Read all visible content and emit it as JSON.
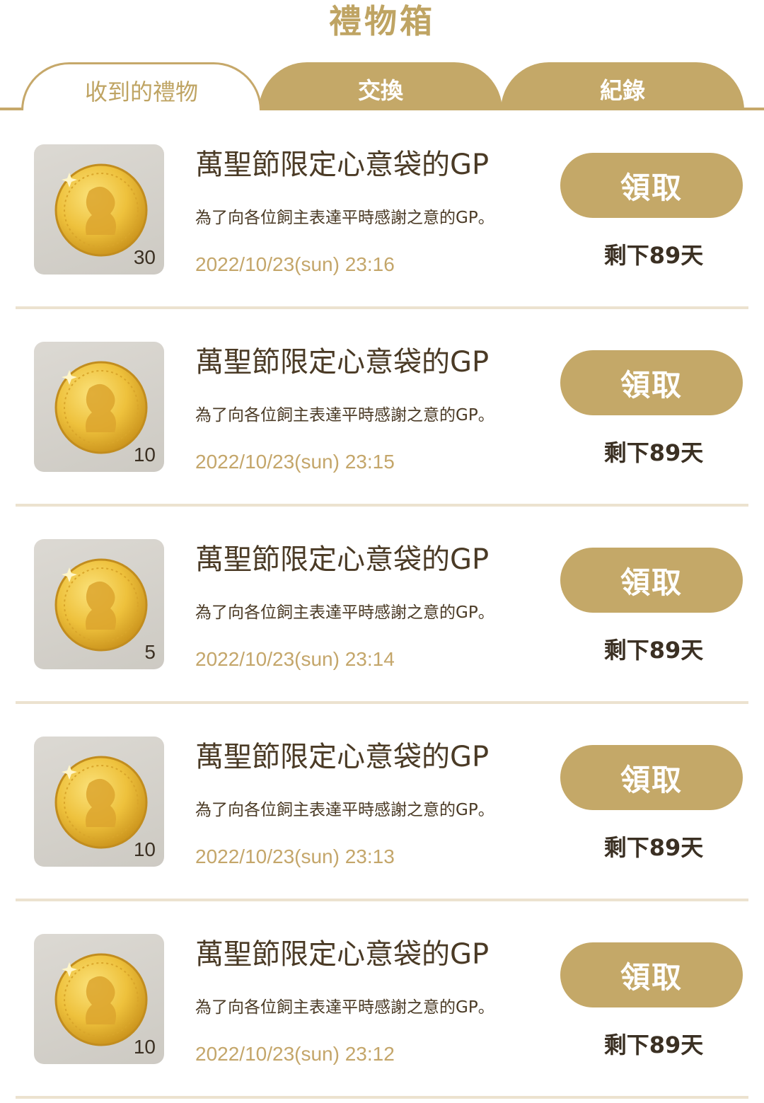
{
  "header": {
    "title": "禮物箱"
  },
  "tabs": [
    {
      "label": "收到的禮物",
      "active": true
    },
    {
      "label": "交換",
      "active": false
    },
    {
      "label": "紀錄",
      "active": false
    }
  ],
  "colors": {
    "accent": "#c4a868",
    "text_dark": "#4a3a25",
    "date_text": "#c4a66a",
    "divider": "#ece2cf"
  },
  "gifts": [
    {
      "icon": "gold-coin-icon",
      "quantity": "30",
      "name": "萬聖節限定心意袋的GP",
      "description": "為了向各位飼主表達平時感謝之意的GP。",
      "date": "2022/10/23(sun) 23:16",
      "claim_label": "領取",
      "remaining": "剩下89天"
    },
    {
      "icon": "gold-coin-icon",
      "quantity": "10",
      "name": "萬聖節限定心意袋的GP",
      "description": "為了向各位飼主表達平時感謝之意的GP。",
      "date": "2022/10/23(sun) 23:15",
      "claim_label": "領取",
      "remaining": "剩下89天"
    },
    {
      "icon": "gold-coin-icon",
      "quantity": "5",
      "name": "萬聖節限定心意袋的GP",
      "description": "為了向各位飼主表達平時感謝之意的GP。",
      "date": "2022/10/23(sun) 23:14",
      "claim_label": "領取",
      "remaining": "剩下89天"
    },
    {
      "icon": "gold-coin-icon",
      "quantity": "10",
      "name": "萬聖節限定心意袋的GP",
      "description": "為了向各位飼主表達平時感謝之意的GP。",
      "date": "2022/10/23(sun) 23:13",
      "claim_label": "領取",
      "remaining": "剩下89天"
    },
    {
      "icon": "gold-coin-icon",
      "quantity": "10",
      "name": "萬聖節限定心意袋的GP",
      "description": "為了向各位飼主表達平時感謝之意的GP。",
      "date": "2022/10/23(sun) 23:12",
      "claim_label": "領取",
      "remaining": "剩下89天"
    }
  ]
}
